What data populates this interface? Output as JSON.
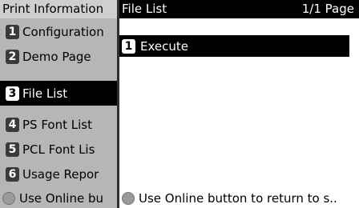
{
  "left_panel": {
    "title": "Print Information",
    "items": [
      {
        "num": "1",
        "label": "Configuration"
      },
      {
        "num": "2",
        "label": "Demo Page"
      },
      {
        "num": "3",
        "label": "File List"
      },
      {
        "num": "4",
        "label": "PS Font List"
      },
      {
        "num": "5",
        "label": "PCL Font Lis"
      },
      {
        "num": "6",
        "label": "Usage Repor"
      }
    ],
    "selected_index": 2,
    "footer_text": "Use Online bu"
  },
  "right_panel": {
    "title": "File List",
    "page_indicator": "1/1 Page",
    "item": {
      "num": "1",
      "label": "Execute"
    },
    "footer_text": "Use Online button to return to s.."
  },
  "icons": {
    "online_button": "circle-button-icon"
  }
}
